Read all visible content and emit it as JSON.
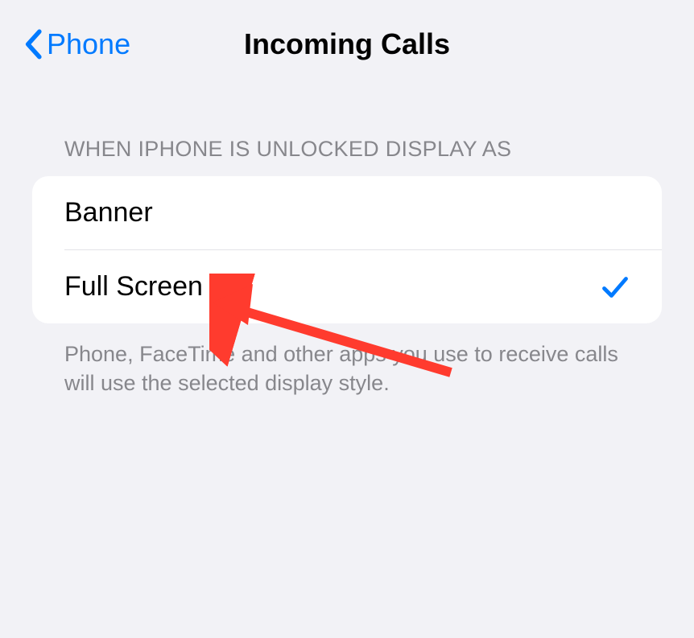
{
  "header": {
    "back_label": "Phone",
    "title": "Incoming Calls"
  },
  "section": {
    "header_text": "WHEN IPHONE IS UNLOCKED DISPLAY AS",
    "footer_text": "Phone, FaceTime and other apps you use to receive calls will use the selected display style."
  },
  "options": {
    "banner_label": "Banner",
    "fullscreen_label": "Full Screen"
  },
  "colors": {
    "accent": "#007aff",
    "annotation": "#ff3b2e"
  }
}
